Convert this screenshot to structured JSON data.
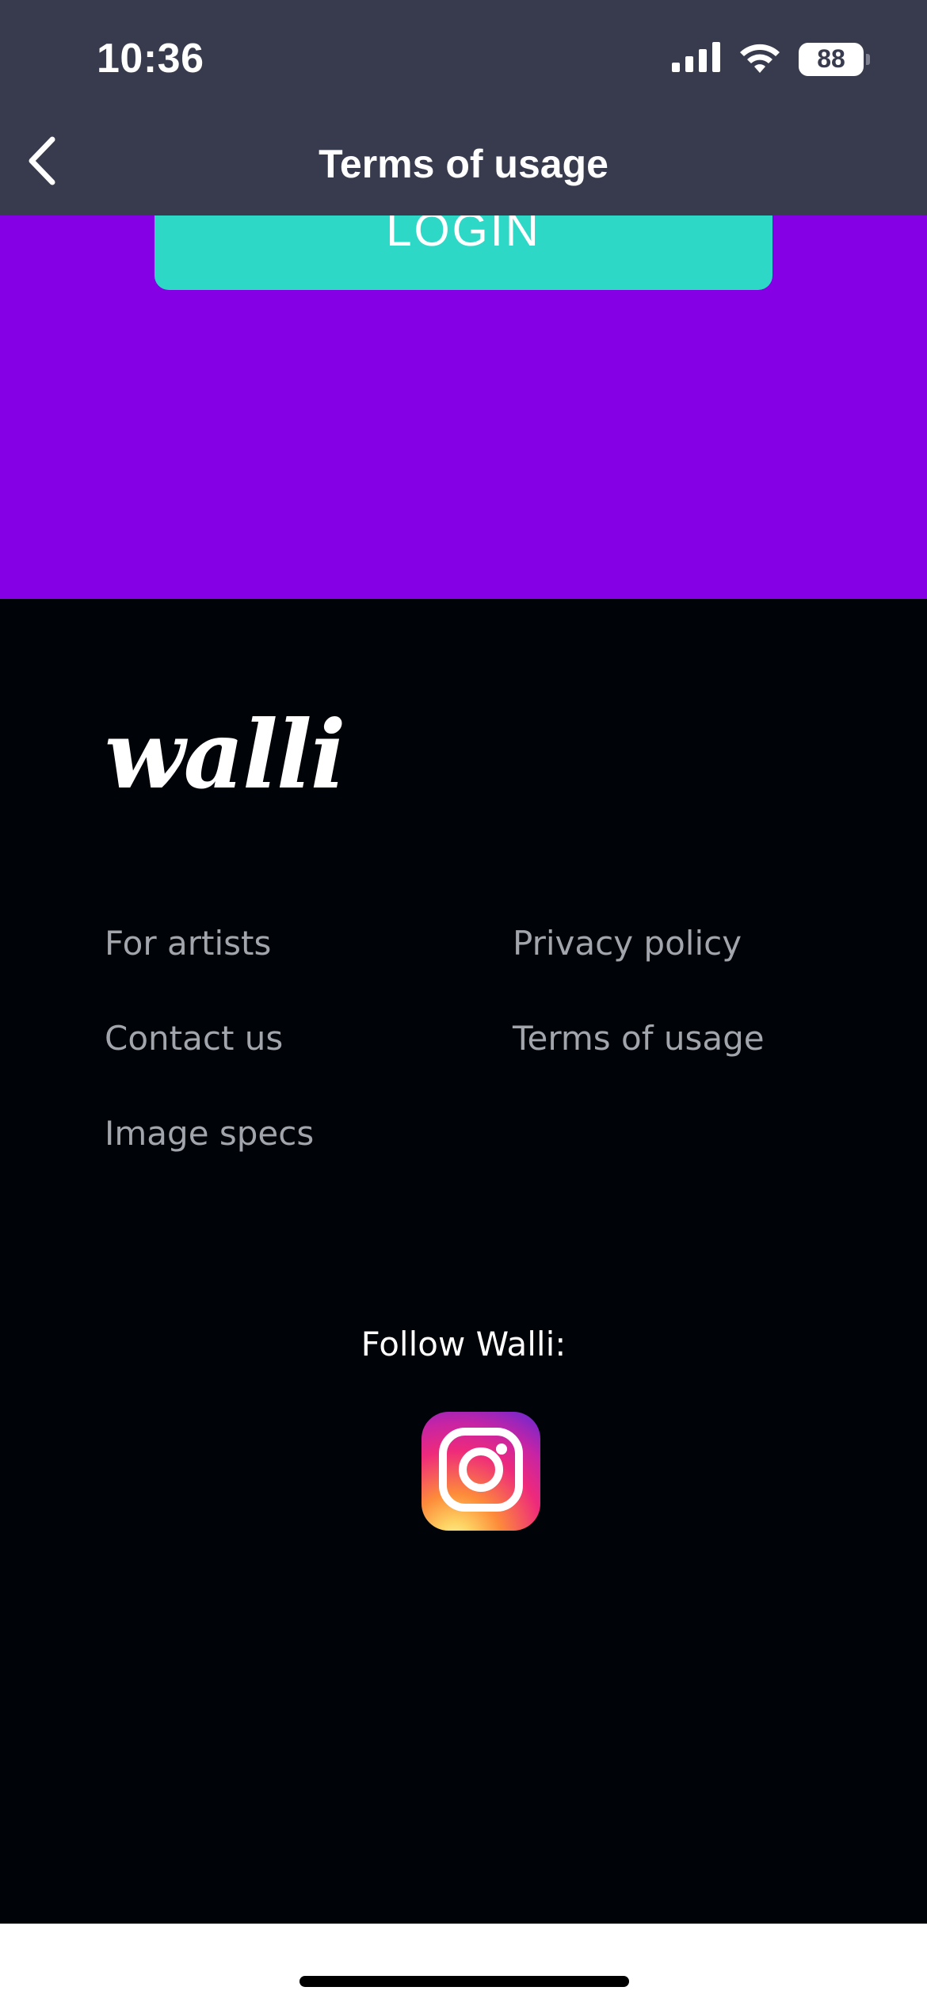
{
  "status_bar": {
    "time": "10:36",
    "battery": "88",
    "icons": [
      "cellular-signal-icon",
      "wifi-icon",
      "battery-icon"
    ]
  },
  "nav": {
    "back_icon": "chevron-left-icon",
    "title": "Terms of usage"
  },
  "hero": {
    "login_label": "LOGIN"
  },
  "footer": {
    "logo": "walli",
    "links_left": [
      "For artists",
      "Contact us",
      "Image specs"
    ],
    "links_right": [
      "Privacy policy",
      "Terms of usage"
    ],
    "follow_label": "Follow Walli:",
    "social_icon": "instagram-icon"
  },
  "colors": {
    "header_bg": "#383b4d",
    "purple_bg": "#8500e4",
    "login_bg": "#2ed8c6",
    "footer_bg": "#000308",
    "link_color": "#a3a5ad"
  }
}
